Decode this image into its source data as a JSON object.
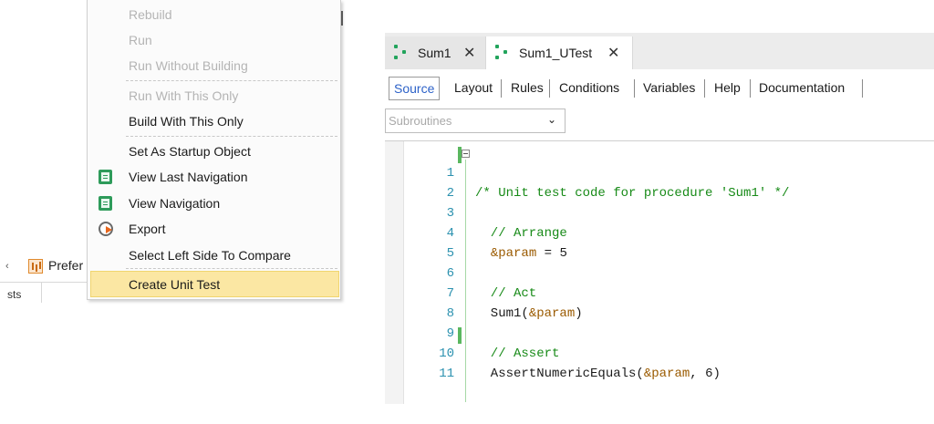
{
  "background": {
    "chevron_glyph": "‹",
    "preferences_tab_label": "Prefer",
    "panel_text": "sts"
  },
  "context_menu": {
    "items": [
      {
        "label": "Rebuild",
        "enabled": false
      },
      {
        "label": "Run",
        "enabled": false
      },
      {
        "label": "Run Without Building",
        "enabled": false
      },
      {
        "label": "Run With This Only",
        "enabled": false
      },
      {
        "label": "Build With This Only",
        "enabled": true
      },
      {
        "label": "Set As Startup Object",
        "enabled": true
      },
      {
        "label": "View Last Navigation",
        "enabled": true,
        "icon": "navigation-report-icon"
      },
      {
        "label": "View Navigation",
        "enabled": true,
        "icon": "navigation-report-icon"
      },
      {
        "label": "Export",
        "enabled": true,
        "icon": "export-icon"
      },
      {
        "label": "Select Left Side To Compare",
        "enabled": true
      },
      {
        "label": "Create Unit Test",
        "enabled": true,
        "highlighted": true
      }
    ]
  },
  "editor": {
    "document_tabs": [
      {
        "label": "Sum1",
        "close": "✕",
        "icon": "procedure-icon",
        "active": false
      },
      {
        "label": "Sum1_UTest",
        "close": "✕",
        "icon": "procedure-icon",
        "active": true
      }
    ],
    "view_tabs": [
      "Source",
      "Layout",
      "Rules",
      "Conditions",
      "Variables",
      "Help",
      "Documentation"
    ],
    "active_view_tab": "Source",
    "subroutines_placeholder": "Subroutines",
    "subroutines_chevron": "⌄",
    "code_lines": [
      {
        "num": "1",
        "text": "/* Unit test code for procedure 'Sum1' */"
      },
      {
        "num": "2",
        "text": ""
      },
      {
        "num": "3",
        "text": "  // Arrange"
      },
      {
        "num": "4",
        "text": "  &param = 5"
      },
      {
        "num": "5",
        "text": ""
      },
      {
        "num": "6",
        "text": "  // Act"
      },
      {
        "num": "7",
        "text": "  Sum1(&param)"
      },
      {
        "num": "8",
        "text": ""
      },
      {
        "num": "9",
        "text": "  // Assert"
      },
      {
        "num": "10",
        "text": "  AssertNumericEquals(&param, 6)"
      },
      {
        "num": "11",
        "text": ""
      }
    ]
  },
  "colors": {
    "menu_highlight": "#fbe7a3",
    "active_tab_text": "#2d62c8",
    "comment": "#178a17",
    "variable": "#9a5a00",
    "line_number": "#2b91af"
  }
}
